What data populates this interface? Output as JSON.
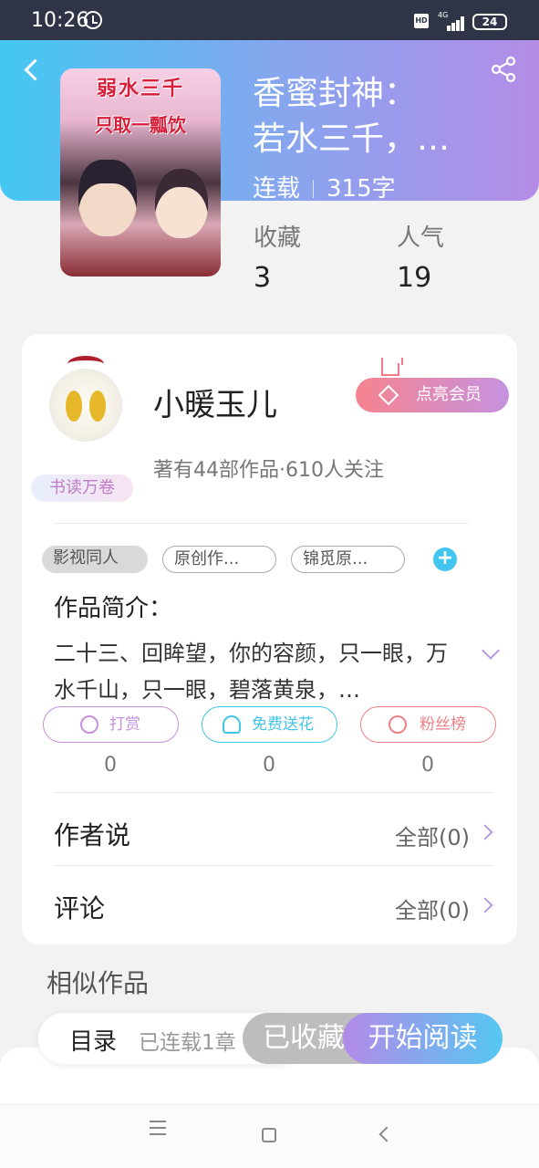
{
  "status_bar": {
    "time": "10:26",
    "network": "4G",
    "hd": "HD",
    "battery": "24"
  },
  "header": {
    "title_line1": "香蜜封神：",
    "title_line2": "若水三千，…",
    "serial_status": "连载",
    "word_count": "315字"
  },
  "cover": {
    "text_top": "弱水三千",
    "text_bottom": "只取一瓢饮"
  },
  "stats": {
    "favorites_label": "收藏",
    "favorites_value": "3",
    "popularity_label": "人气",
    "popularity_value": "19"
  },
  "author": {
    "name": "小暖玉儿",
    "badge": "书读万卷",
    "vip_button": "点亮会员",
    "meta": "著有44部作品·610人关注"
  },
  "tags": [
    "影视同人",
    "原创作...",
    "锦觅原..."
  ],
  "intro": {
    "title": "作品简介：",
    "text": "二十三、回眸望，你的容颜，只一眼，万水千山，只一眼，碧落黄泉，…"
  },
  "actions": [
    {
      "label": "打赏",
      "count": "0",
      "color": "#c78fdc"
    },
    {
      "label": "免费送花",
      "count": "0",
      "color": "#43c5e6"
    },
    {
      "label": "粉丝榜",
      "count": "0",
      "color": "#ef7f86"
    }
  ],
  "rows": {
    "author_says_label": "作者说",
    "author_says_value": "全部(0)",
    "comments_label": "评论",
    "comments_value": "全部(0)"
  },
  "similar_title": "相似作品",
  "bottom_bar": {
    "catalog": "目录",
    "serial_info": "已连载1章",
    "favorited": "已收藏",
    "start_reading": "开始阅读"
  }
}
